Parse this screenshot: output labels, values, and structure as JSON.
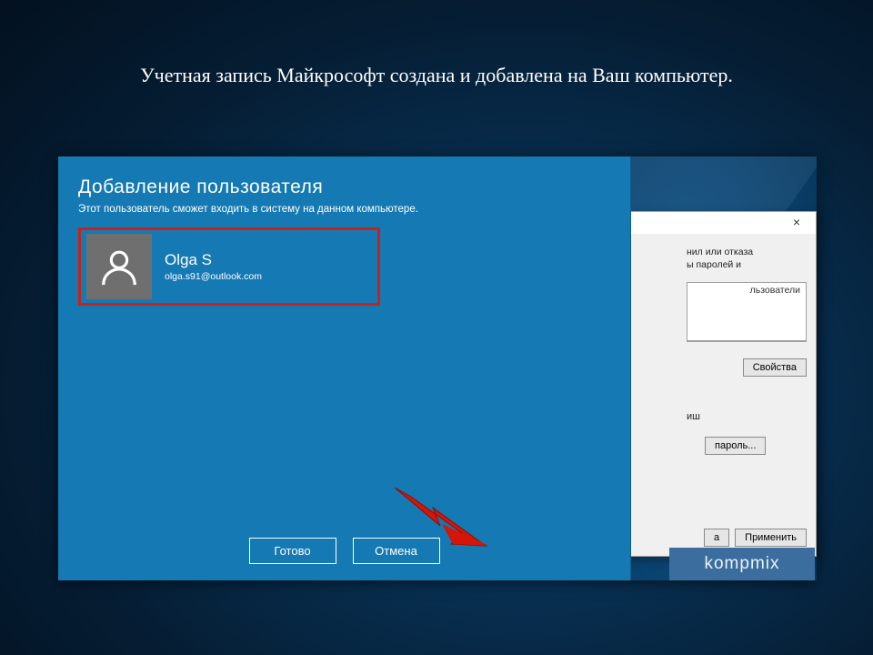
{
  "caption": "Учетная запись Майкрософт создана и добавлена на Ваш компьютер.",
  "panel": {
    "title": "Добавление пользователя",
    "subtitle": "Этот пользователь сможет входить в систему на данном компьютере.",
    "user_name": "Olga S",
    "user_email": "olga.s91@outlook.com",
    "done": "Готово",
    "cancel": "Отмена"
  },
  "classic": {
    "hint1": "нил или отказа",
    "hint2": "ы паролей и",
    "list_header": "льзователи",
    "properties": "Свойства",
    "change_label": "иш",
    "password": "пароль...",
    "close": "а",
    "apply": "Применить"
  },
  "watermark": "kompmix"
}
